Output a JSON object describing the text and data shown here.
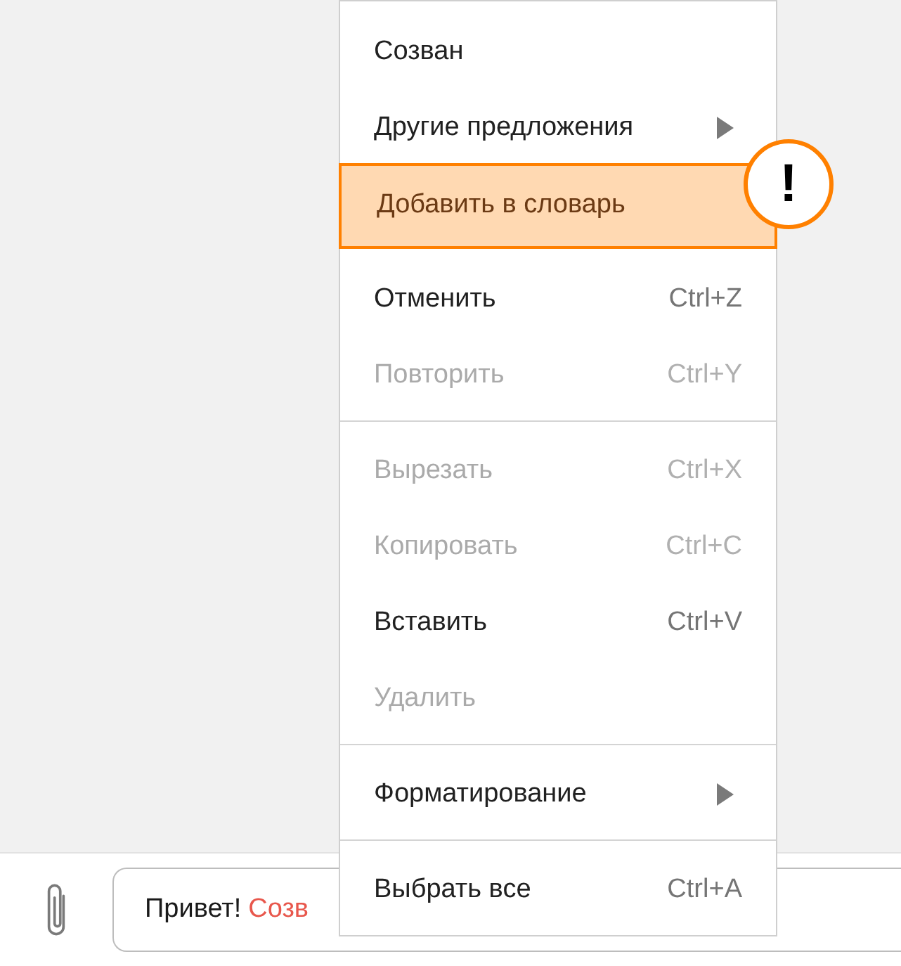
{
  "composer": {
    "value_parts": [
      {
        "text": "Привет!",
        "misspelled": false
      },
      {
        "text": "Созв",
        "misspelled": true
      }
    ]
  },
  "context_menu": {
    "callout": {
      "text": "!"
    },
    "spelling_items": [
      {
        "label": "Созван",
        "disabled": false,
        "submenu": false,
        "highlighted": false
      },
      {
        "label": "Другие предложения",
        "disabled": false,
        "submenu": true,
        "highlighted": false
      },
      {
        "label": "Добавить в словарь",
        "disabled": false,
        "submenu": false,
        "highlighted": true
      }
    ],
    "groups": [
      [
        {
          "label": "Отменить",
          "shortcut": "Ctrl+Z",
          "disabled": false,
          "submenu": false,
          "highlighted": false
        },
        {
          "label": "Повторить",
          "shortcut": "Ctrl+Y",
          "disabled": true,
          "submenu": false,
          "highlighted": false
        }
      ],
      [
        {
          "label": "Вырезать",
          "shortcut": "Ctrl+X",
          "disabled": true,
          "submenu": false,
          "highlighted": false
        },
        {
          "label": "Копировать",
          "shortcut": "Ctrl+C",
          "disabled": true,
          "submenu": false,
          "highlighted": false
        },
        {
          "label": "Вставить",
          "shortcut": "Ctrl+V",
          "disabled": false,
          "submenu": false,
          "highlighted": false
        },
        {
          "label": "Удалить",
          "disabled": true,
          "submenu": false,
          "highlighted": false
        }
      ],
      [
        {
          "label": "Форматирование",
          "disabled": false,
          "submenu": true,
          "highlighted": false
        }
      ],
      [
        {
          "label": "Выбрать все",
          "shortcut": "Ctrl+A",
          "disabled": false,
          "submenu": false,
          "highlighted": false
        }
      ]
    ]
  }
}
